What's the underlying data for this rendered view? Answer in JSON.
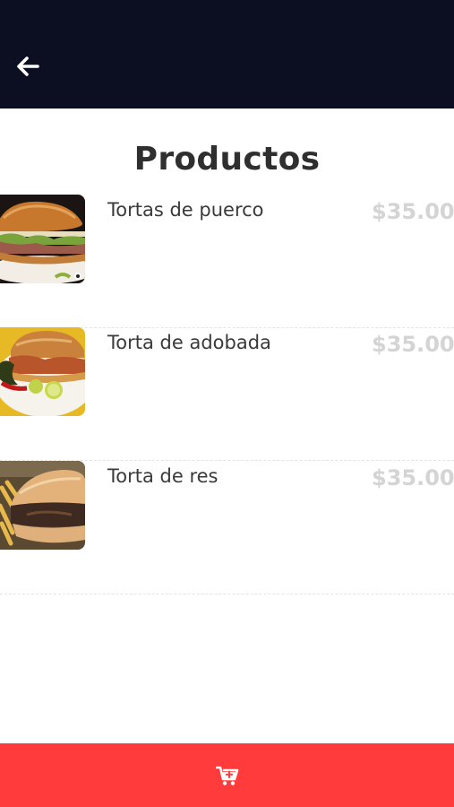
{
  "header": {
    "back_icon": "arrow-left-icon",
    "background": "#0c0e22"
  },
  "page": {
    "title": "Productos"
  },
  "products": [
    {
      "name": "Tortas de puerco",
      "price": "$35.00",
      "image": "torta-puerco-photo"
    },
    {
      "name": "Torta de adobada",
      "price": "$35.00",
      "image": "torta-adobada-photo"
    },
    {
      "name": "Torta de res",
      "price": "$35.00",
      "image": "torta-res-photo"
    }
  ],
  "footer": {
    "cart_icon": "cart-plus-icon",
    "background": "#ff3b3b"
  }
}
